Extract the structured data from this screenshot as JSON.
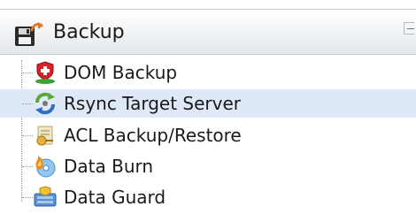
{
  "panel": {
    "title": "Backup",
    "header_icon": "save-disk-with-arrow-icon",
    "collapse_icon": "collapse-icon"
  },
  "tree": {
    "items": [
      {
        "label": "DOM Backup",
        "icon": "dom-backup-icon",
        "selected": false
      },
      {
        "label": "Rsync Target Server",
        "icon": "rsync-sync-icon",
        "selected": true
      },
      {
        "label": "ACL Backup/Restore",
        "icon": "acl-backup-icon",
        "selected": false
      },
      {
        "label": "Data Burn",
        "icon": "data-burn-icon",
        "selected": false
      },
      {
        "label": "Data Guard",
        "icon": "data-guard-icon",
        "selected": false
      }
    ]
  },
  "colors": {
    "selection": "#dfe8f6",
    "header_border": "#c9cfd6",
    "text": "#1a1a1a"
  }
}
